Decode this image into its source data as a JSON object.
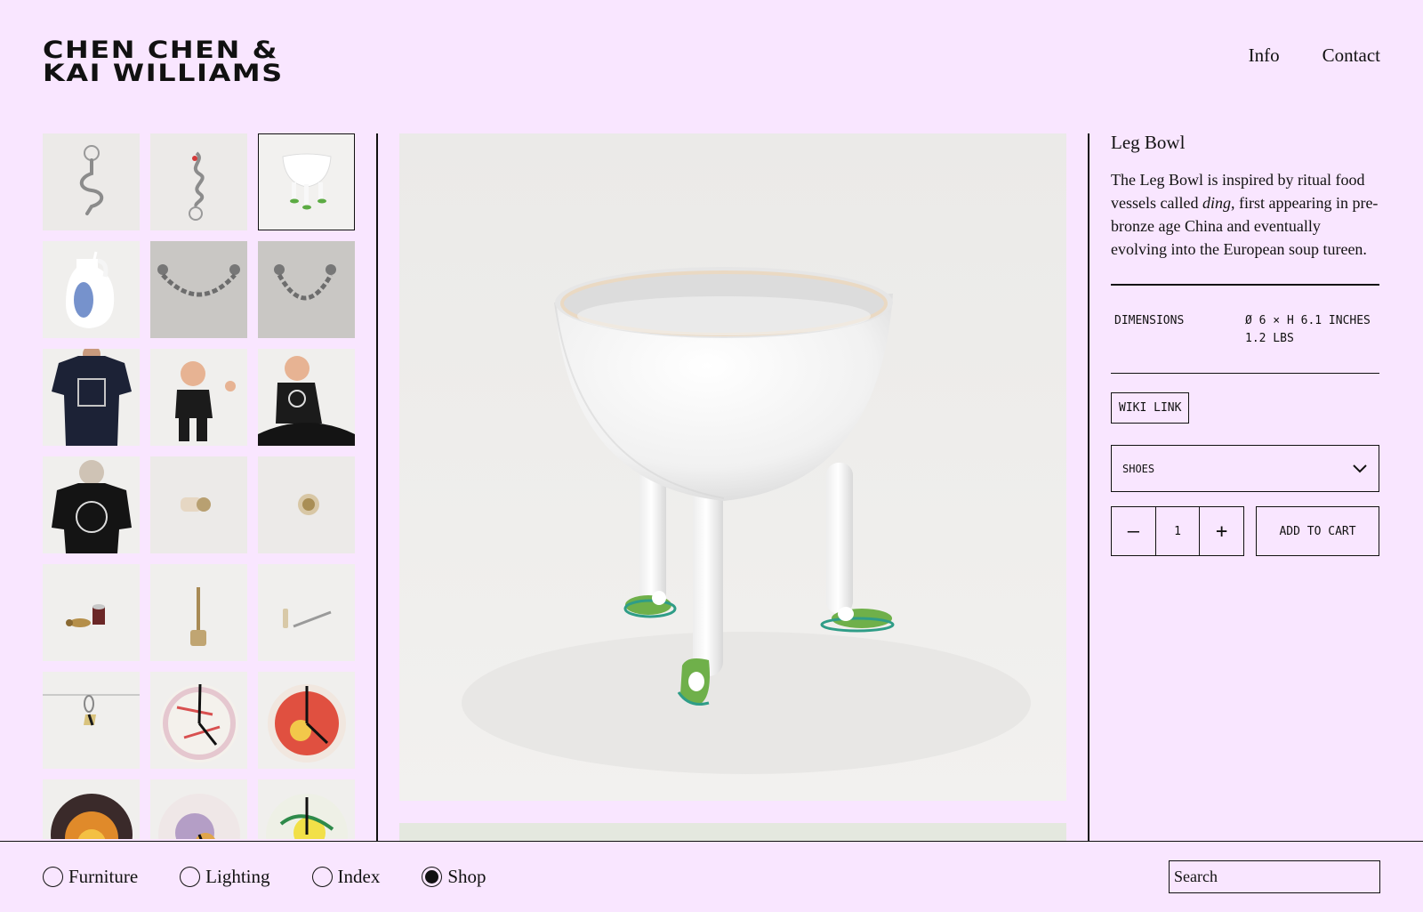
{
  "brand": {
    "line1": "CHEN CHEN &",
    "line2": "KAI WILLIAMS"
  },
  "nav": {
    "info": "Info",
    "contact": "Contact"
  },
  "thumbnails": [
    {
      "icon": "keychain-s-hook"
    },
    {
      "icon": "keychain-twisted-red"
    },
    {
      "icon": "leg-bowl",
      "selected": true
    },
    {
      "icon": "vase-blue-brush"
    },
    {
      "icon": "chain-hook"
    },
    {
      "icon": "chain-hook"
    },
    {
      "icon": "navy-tshirt-back"
    },
    {
      "icon": "baby-black-tee"
    },
    {
      "icon": "baby-black-tee-back"
    },
    {
      "icon": "black-tshirt-back"
    },
    {
      "icon": "wall-knob"
    },
    {
      "icon": "wall-knob-front"
    },
    {
      "icon": "brass-candle-pieces"
    },
    {
      "icon": "brass-stand"
    },
    {
      "icon": "brass-pins"
    },
    {
      "icon": "wire-keychain"
    },
    {
      "icon": "clock-plate-white"
    },
    {
      "icon": "clock-plate-red"
    },
    {
      "icon": "clock-plate-dark"
    },
    {
      "icon": "clock-plate-purple"
    },
    {
      "icon": "clock-plate-yellow"
    }
  ],
  "product": {
    "title": "Leg Bowl",
    "desc_1": "The Leg Bowl is inspired by ritual food vessels called ",
    "desc_em": "ding",
    "desc_2": ", first appearing in pre-bronze age China and eventually evolving into the European soup tureen.",
    "dimensions_label": "DIMENSIONS",
    "dimensions_value": "Ø 6 × H 6.1 INCHES 1.2 LBS",
    "wiki_label": "WIKI LINK",
    "variant": "SHOES",
    "qty_minus": "—",
    "qty_value": "1",
    "qty_plus": "+",
    "add_to_cart": "ADD TO CART"
  },
  "footer": {
    "categories": [
      {
        "label": "Furniture",
        "selected": false
      },
      {
        "label": "Lighting",
        "selected": false
      },
      {
        "label": "Index",
        "selected": false
      },
      {
        "label": "Shop",
        "selected": true
      }
    ],
    "search_placeholder": "Search"
  },
  "colors": {
    "background": "#f9e6ff",
    "ink": "#111111",
    "slipper_green": "#6fb04a"
  }
}
